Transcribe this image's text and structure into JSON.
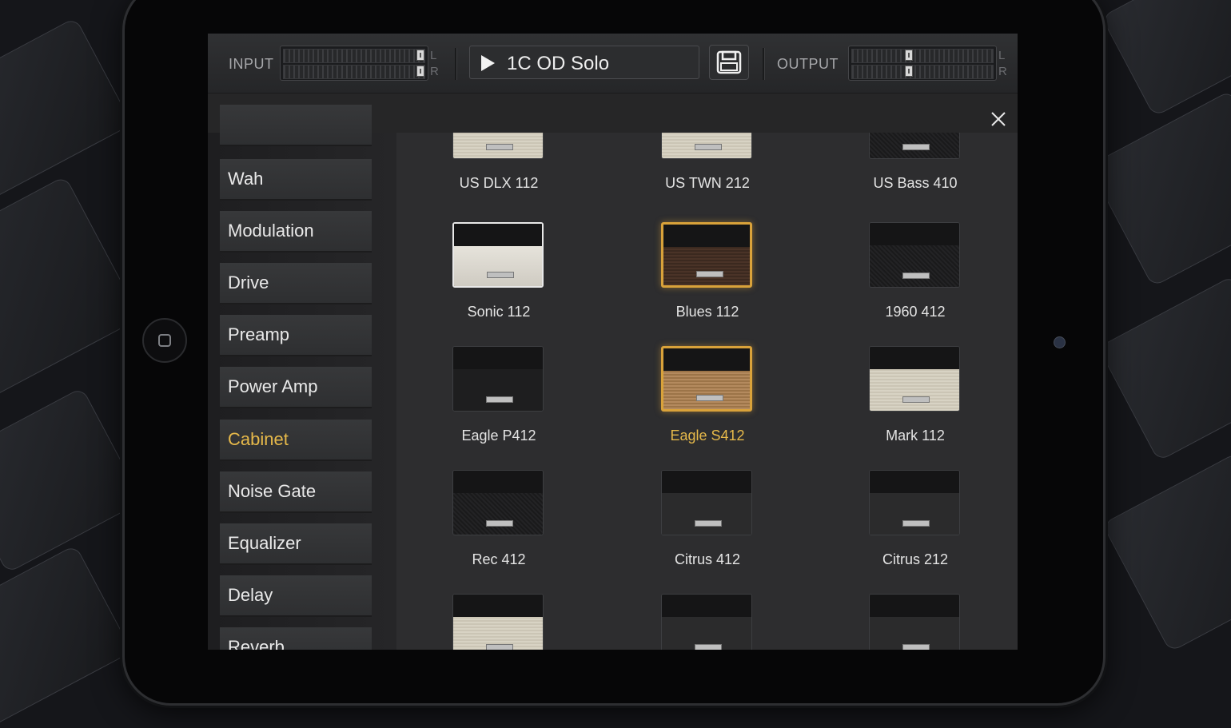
{
  "header": {
    "input_label": "INPUT",
    "output_label": "OUTPUT",
    "meter_left": "L",
    "meter_right": "R",
    "preset_name": "1C OD Solo"
  },
  "colors": {
    "accent": "#E6B94A",
    "background": "#262627",
    "text": "#EAEAEA"
  },
  "sidebar": {
    "items": [
      {
        "label": "Wah"
      },
      {
        "label": "Modulation"
      },
      {
        "label": "Drive"
      },
      {
        "label": "Preamp"
      },
      {
        "label": "Power Amp"
      },
      {
        "label": "Cabinet",
        "active": true
      },
      {
        "label": "Noise Gate"
      },
      {
        "label": "Equalizer"
      },
      {
        "label": "Delay"
      },
      {
        "label": "Reverb"
      }
    ]
  },
  "cabinets": {
    "items": [
      {
        "name": "US DLX 112"
      },
      {
        "name": "US TWN 212"
      },
      {
        "name": "US Bass 410"
      },
      {
        "name": "Sonic 112"
      },
      {
        "name": "Blues 112"
      },
      {
        "name": "1960 412"
      },
      {
        "name": "Eagle P412"
      },
      {
        "name": "Eagle S412",
        "selected": true
      },
      {
        "name": "Mark 112"
      },
      {
        "name": "Rec 412"
      },
      {
        "name": "Citrus 412"
      },
      {
        "name": "Citrus 212"
      }
    ]
  },
  "icons": {
    "play": "play-icon",
    "save": "save-icon",
    "close": "close-icon",
    "home": "home-button-icon"
  }
}
